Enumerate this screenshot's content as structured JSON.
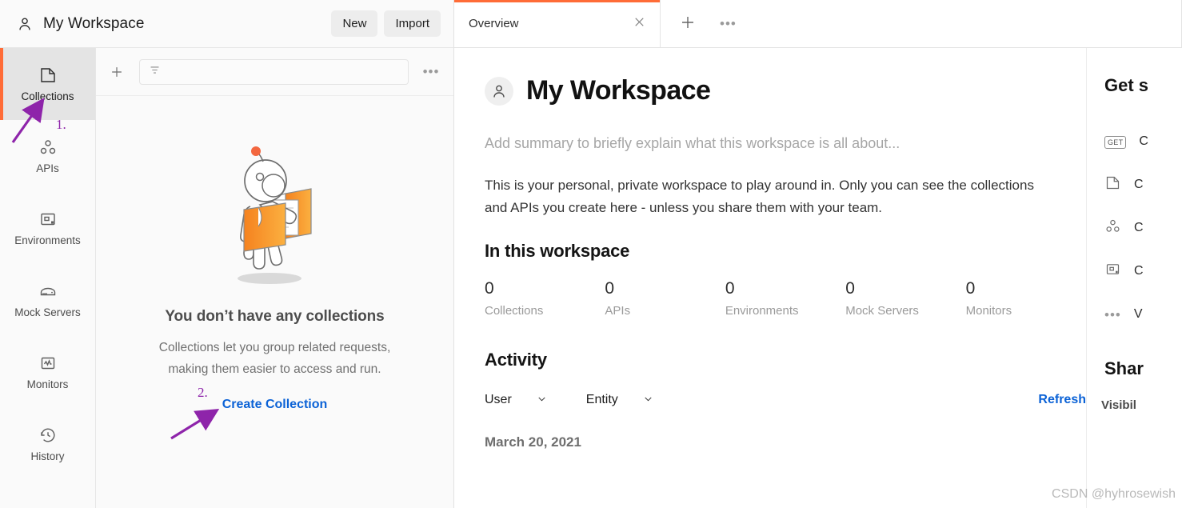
{
  "workspace": {
    "name": "My Workspace",
    "avatar_icon": "person-icon",
    "actions": [
      {
        "label": "New",
        "name": "new-button"
      },
      {
        "label": "Import",
        "name": "import-button"
      }
    ]
  },
  "rail": {
    "items": [
      {
        "label": "Collections",
        "icon": "collection-icon",
        "active": true
      },
      {
        "label": "APIs",
        "icon": "apis-icon",
        "active": false
      },
      {
        "label": "Environments",
        "icon": "environment-icon",
        "active": false
      },
      {
        "label": "Mock Servers",
        "icon": "mock-server-icon",
        "active": false
      },
      {
        "label": "Monitors",
        "icon": "monitor-icon",
        "active": false
      },
      {
        "label": "History",
        "icon": "history-icon",
        "active": false
      }
    ]
  },
  "collections_toolbar": {
    "add_icon": "plus-icon",
    "filter_icon": "filter-icon",
    "filter_value": "",
    "filter_placeholder": "",
    "more_icon": "more-horizontal-icon"
  },
  "empty_state": {
    "illustration": "person-carrying-box-illustration",
    "title": "You don’t have any collections",
    "subtitle_line1": "Collections let you group related requests,",
    "subtitle_line2": "making them easier to access and run.",
    "cta": "Create Collection"
  },
  "tabbar": {
    "tabs": [
      {
        "label": "Overview",
        "active": true,
        "close_icon": "close-icon"
      }
    ],
    "new_tab_icon": "plus-icon",
    "tab_more_icon": "more-horizontal-icon"
  },
  "overview": {
    "avatar_icon": "person-icon",
    "title": "My Workspace",
    "summary_placeholder": "Add summary to briefly explain what this workspace is all about...",
    "description": "This is your personal, private workspace to play around in. Only you can see the collections and APIs you create here - unless you share them with your team.",
    "in_this_workspace": {
      "heading": "In this workspace",
      "stats": [
        {
          "count": "0",
          "label": "Collections"
        },
        {
          "count": "0",
          "label": "APIs"
        },
        {
          "count": "0",
          "label": "Environments"
        },
        {
          "count": "0",
          "label": "Mock Servers"
        },
        {
          "count": "0",
          "label": "Monitors"
        }
      ]
    },
    "activity": {
      "heading": "Activity",
      "user_filter": "User",
      "entity_filter": "Entity",
      "chevron_icon": "chevron-down-icon",
      "refresh": "Refresh",
      "date_group": "March 20, 2021"
    }
  },
  "rightbar": {
    "get_started_title": "Get s",
    "items": [
      {
        "label": "C",
        "icon": "get-method-icon"
      },
      {
        "label": "C",
        "icon": "collection-icon"
      },
      {
        "label": "C",
        "icon": "apis-icon"
      },
      {
        "label": "C",
        "icon": "environment-icon"
      },
      {
        "label": "V",
        "icon": "more-horizontal-icon"
      }
    ],
    "share_title": "Shar",
    "visibility_label": "Visibil"
  },
  "annotations": {
    "step1": "1.",
    "step2": "2.",
    "arrow_color": "#8e24aa"
  },
  "watermark": "CSDN @hyhrosewish",
  "colors": {
    "accent_orange": "#ff6c37",
    "link_blue": "#0b62d6",
    "annotation_purple": "#8e24aa"
  }
}
